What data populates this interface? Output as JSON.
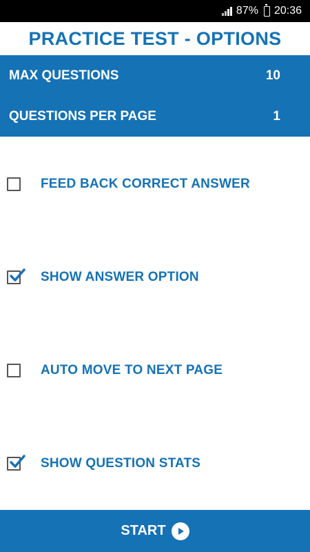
{
  "status_bar": {
    "battery": "87%",
    "time": "20:36",
    "icons": [
      "signal-icon",
      "battery-charging-icon"
    ]
  },
  "header": {
    "title": "PRACTICE TEST - OPTIONS"
  },
  "settings": [
    {
      "label": "MAX QUESTIONS",
      "value": "10"
    },
    {
      "label": "QUESTIONS PER PAGE",
      "value": "1"
    }
  ],
  "options": [
    {
      "label": "FEED BACK CORRECT ANSWER",
      "checked": false
    },
    {
      "label": "SHOW ANSWER OPTION",
      "checked": true
    },
    {
      "label": "AUTO MOVE TO NEXT PAGE",
      "checked": false
    },
    {
      "label": "SHOW QUESTION STATS",
      "checked": true
    }
  ],
  "footer": {
    "start_label": "START",
    "start_icon": "play-circle-icon"
  },
  "colors": {
    "primary": "#1572b5",
    "check": "#1572b5",
    "status_bar": "#000000"
  }
}
